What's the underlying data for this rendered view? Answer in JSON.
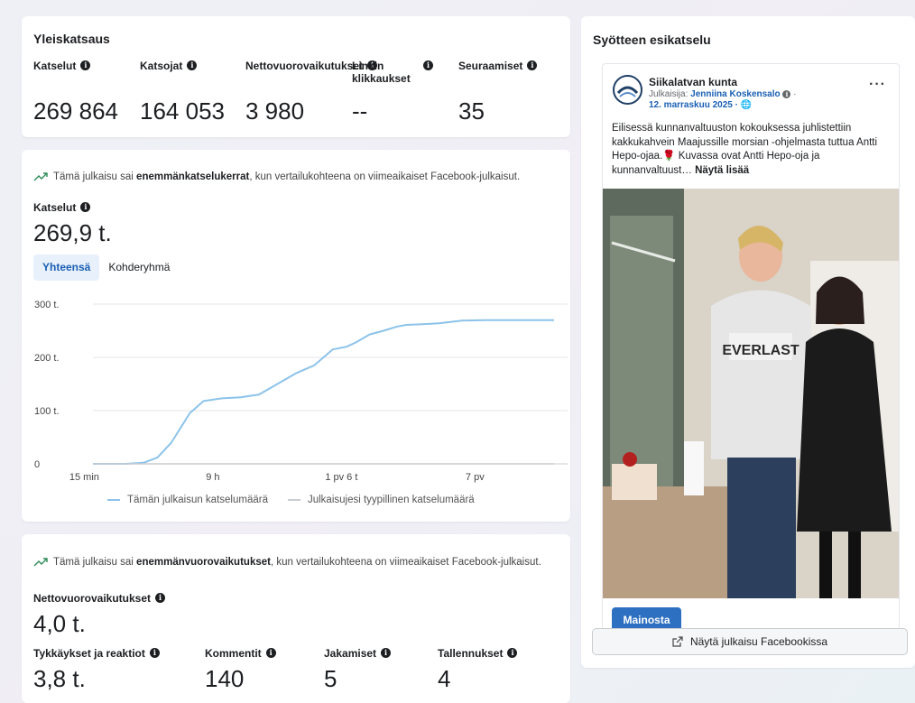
{
  "overview": {
    "title": "Yleiskatsaus",
    "metrics": [
      {
        "label": "Katselut",
        "value": "269 864"
      },
      {
        "label": "Katsojat",
        "value": "164 053"
      },
      {
        "label": "Nettovuorovaikutukset",
        "value": "3 980"
      },
      {
        "label": "Linkin klikkaukset",
        "value": "--"
      },
      {
        "label": "Seuraamiset",
        "value": "35"
      }
    ]
  },
  "views_card": {
    "trend_prefix": "Tämä julkaisu sai ",
    "trend_bold": "enemmänkatselukerrat",
    "trend_suffix": ", kun vertailukohteena on viimeaikaiset Facebook-julkaisut.",
    "metric_label": "Katselut",
    "metric_value": "269,9 t.",
    "tabs": [
      "Yhteensä",
      "Kohderyhmä"
    ],
    "active_tab": "Yhteensä"
  },
  "chart_data": {
    "type": "line",
    "x_ticks": [
      "15 min",
      "9 h",
      "1 pv 6 t",
      "7 pv"
    ],
    "y_ticks": [
      "0",
      "100 t.",
      "200 t.",
      "300 t."
    ],
    "ylim": [
      0,
      300
    ],
    "grid": true,
    "legend_position": "bottom",
    "series": [
      {
        "name": "Tämän julkaisun katselumäärä",
        "color": "#8cc3ea",
        "x": [
          0,
          0.07,
          0.11,
          0.14,
          0.17,
          0.21,
          0.24,
          0.28,
          0.32,
          0.36,
          0.4,
          0.44,
          0.48,
          0.52,
          0.55,
          0.57,
          0.6,
          0.63,
          0.66,
          0.68,
          0.71,
          0.75,
          0.8,
          0.85,
          0.9,
          1.0
        ],
        "values": [
          0,
          0,
          2,
          12,
          40,
          95,
          118,
          123,
          125,
          130,
          150,
          170,
          185,
          215,
          220,
          228,
          243,
          250,
          258,
          261,
          262,
          264,
          269,
          270,
          270,
          270
        ]
      },
      {
        "name": "Julkaisujesi tyypillinen katselumäärä",
        "color": "#c9ccd1",
        "x": [
          0,
          1.0
        ],
        "values": [
          0,
          0
        ]
      }
    ]
  },
  "interactions_card": {
    "trend_prefix": "Tämä julkaisu sai ",
    "trend_bold": "enemmänvuorovaikutukset",
    "trend_suffix": ", kun vertailukohteena on viimeaikaiset Facebook-julkaisut.",
    "net_label": "Nettovuorovaikutukset",
    "net_value": "4,0 t.",
    "metrics": [
      {
        "label": "Tykkäykset ja reaktiot",
        "value": "3,8 t."
      },
      {
        "label": "Kommentit",
        "value": "140"
      },
      {
        "label": "Jakamiset",
        "value": "5"
      },
      {
        "label": "Tallennukset",
        "value": "4"
      }
    ]
  },
  "preview": {
    "title": "Syötteen esikatselu",
    "page_name": "Siikalatvan kunta",
    "published_by_prefix": "Julkaisija: ",
    "publisher": "Jenniina Koskensalo",
    "date": "12. marraskuu 2025 ·",
    "text_line": "Eilisessä kunnanvaltuuston kokouksessa juhlistettiin kakkukahvein Maajussille morsian -ohjelmasta tuttua Antti Hepo-ojaa.🌹 Kuvassa ovat Antti Hepo-oja ja kunnanvaltuust… ",
    "see_more": "Näytä lisää",
    "promote_label": "Mainosta",
    "view_on_facebook": "Näytä julkaisu Facebookissa",
    "shirt_text": "EVERLAST"
  }
}
